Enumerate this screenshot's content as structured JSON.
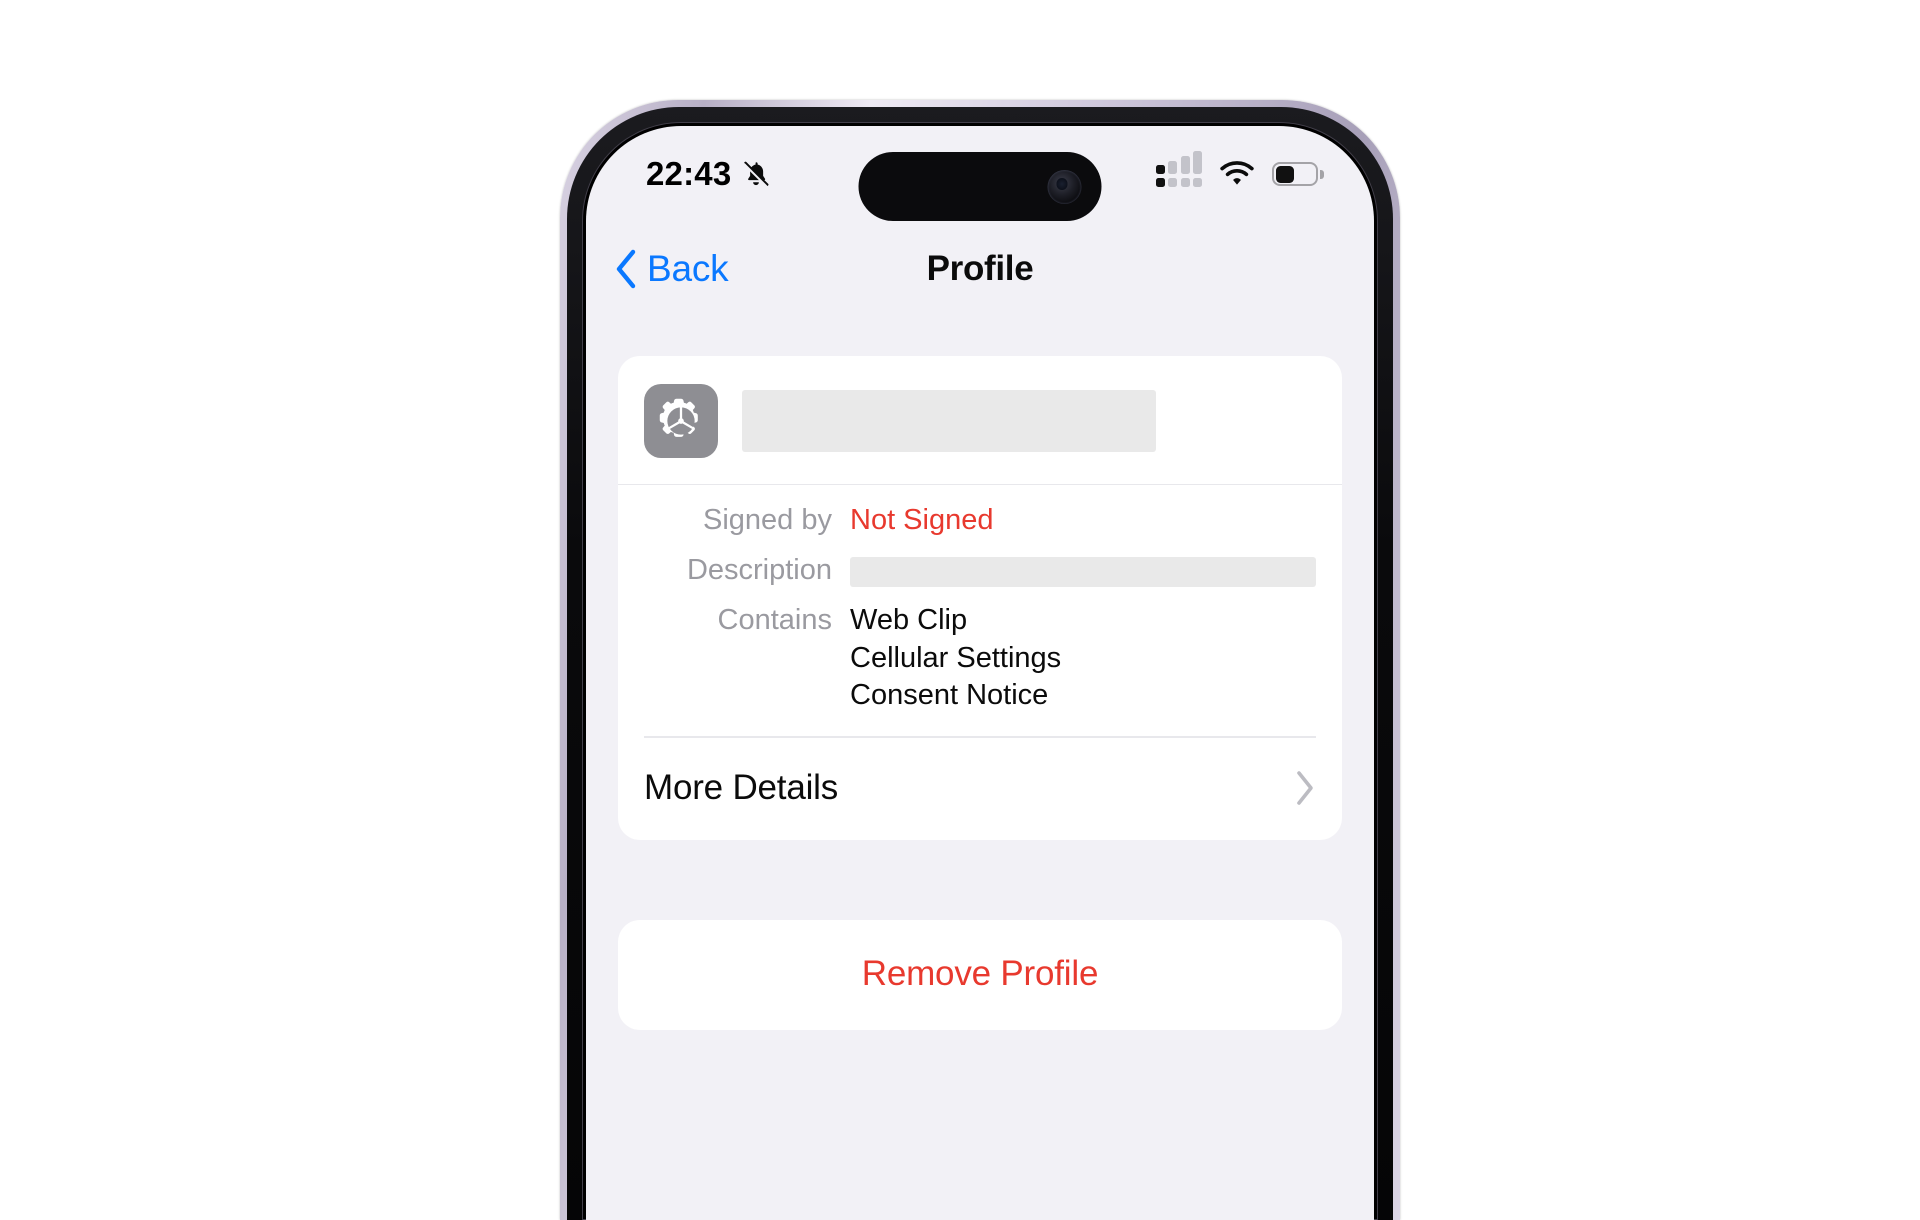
{
  "device": {
    "type": "iphone",
    "frame_color": "#cfc8dc",
    "bezel_color": "#0a0a0c"
  },
  "status_bar": {
    "time": "22:43",
    "mute_icon": "bell-slash-icon",
    "cellular_icon": "cellular-signal-icon",
    "wifi_icon": "wifi-icon",
    "battery_icon": "battery-icon",
    "battery_level_percent": 40
  },
  "nav": {
    "back_label": "Back",
    "back_icon": "chevron-left-icon",
    "title": "Profile",
    "accent_color": "#0a78ff"
  },
  "profile_card": {
    "app_icon": "gear-icon",
    "profile_name_redacted": true,
    "rows": [
      {
        "label": "Signed by",
        "value": "Not Signed",
        "style": "danger"
      },
      {
        "label": "Description",
        "value": "",
        "redacted": true
      },
      {
        "label": "Contains",
        "items": [
          "Web Clip",
          "Cellular Settings",
          "Consent Notice"
        ]
      }
    ],
    "more_details": {
      "label": "More Details",
      "disclosure_icon": "chevron-right-icon"
    }
  },
  "actions": {
    "remove_label": "Remove Profile",
    "remove_color": "#e8392e"
  }
}
